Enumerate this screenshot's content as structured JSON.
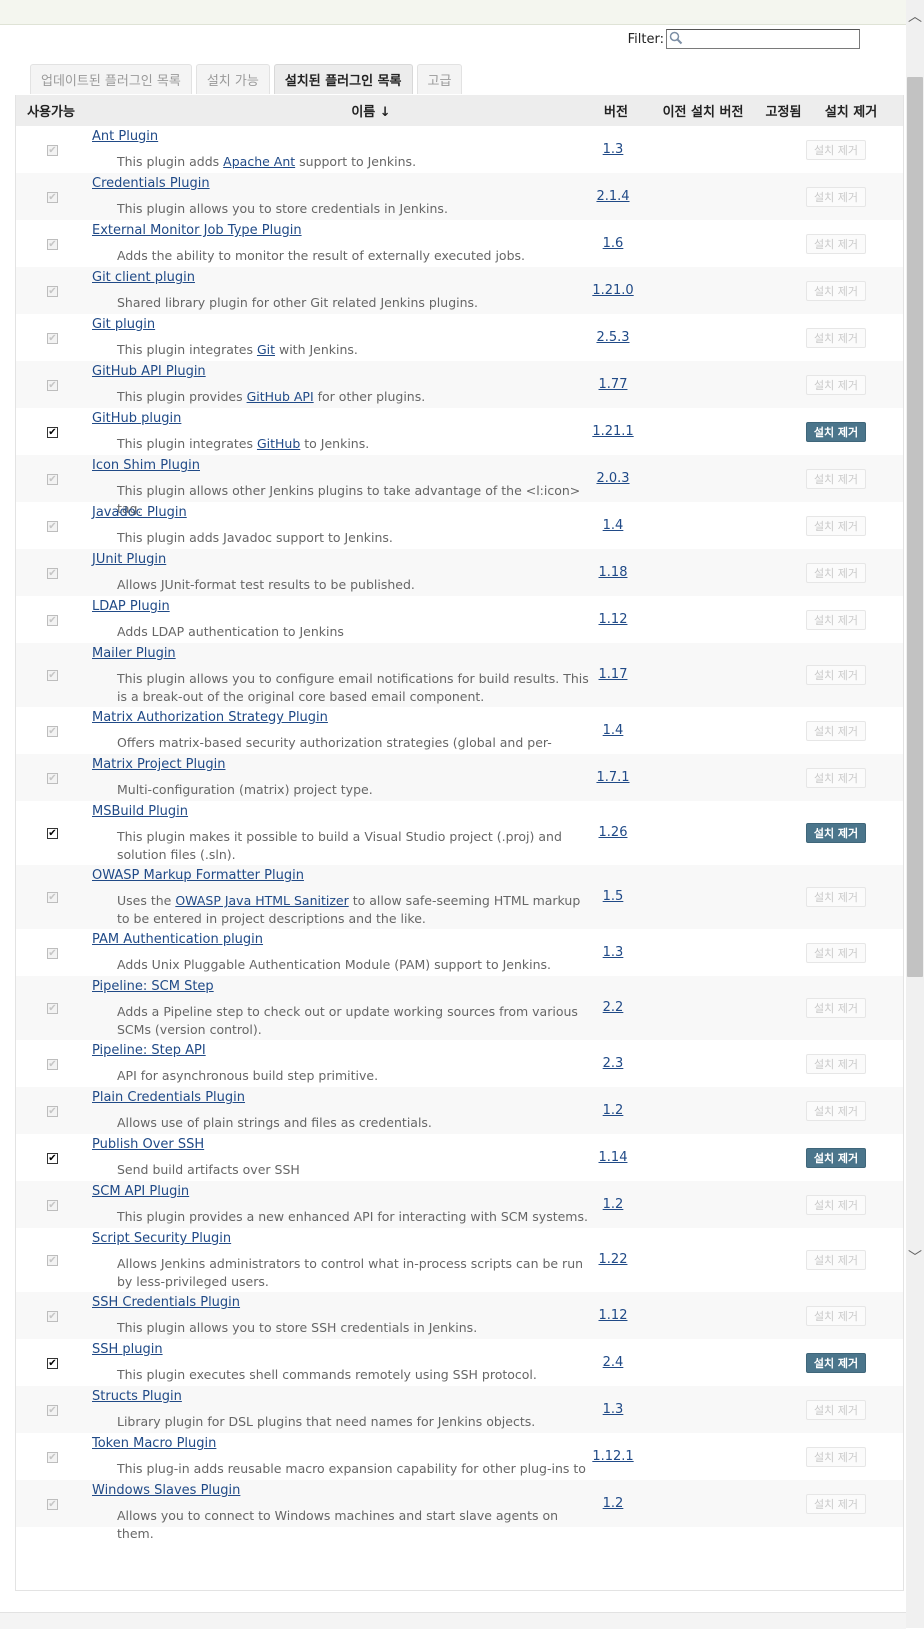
{
  "filter": {
    "label": "Filter:",
    "value": ""
  },
  "tabs": [
    {
      "label": "업데이트된 플러그인 목록",
      "active": false
    },
    {
      "label": "설치 가능",
      "active": false
    },
    {
      "label": "설치된 플러그인 목록",
      "active": true
    },
    {
      "label": "고급",
      "active": false
    }
  ],
  "table": {
    "headers": {
      "enabled": "사용가능",
      "name": "이름 ↓",
      "version": "버전",
      "previous": "이전 설치 버전",
      "pinned": "고정됨",
      "uninstall": "설치 제거"
    },
    "uninstall_label": "설치 제거",
    "rows": [
      {
        "name": "Ant Plugin",
        "desc": [
          [
            "This plugin adds ",
            false
          ],
          [
            "Apache Ant",
            true
          ],
          [
            " support to Jenkins.",
            false
          ]
        ],
        "version": "1.3",
        "enabled": false
      },
      {
        "name": "Credentials Plugin",
        "desc": [
          [
            "This plugin allows you to store credentials in Jenkins.",
            false
          ]
        ],
        "version": "2.1.4",
        "enabled": false
      },
      {
        "name": "External Monitor Job Type Plugin",
        "desc": [
          [
            "Adds the ability to monitor the result of externally executed jobs.",
            false
          ]
        ],
        "version": "1.6",
        "enabled": false
      },
      {
        "name": "Git client plugin",
        "desc": [
          [
            "Shared library plugin for other Git related Jenkins plugins.",
            false
          ]
        ],
        "version": "1.21.0",
        "enabled": false
      },
      {
        "name": "Git plugin",
        "desc": [
          [
            "This plugin integrates ",
            false
          ],
          [
            "Git",
            true
          ],
          [
            " with Jenkins.",
            false
          ]
        ],
        "version": "2.5.3",
        "enabled": false
      },
      {
        "name": "GitHub API Plugin",
        "desc": [
          [
            "This plugin provides ",
            false
          ],
          [
            "GitHub API",
            true
          ],
          [
            " for other plugins.",
            false
          ]
        ],
        "version": "1.77",
        "enabled": false
      },
      {
        "name": "GitHub plugin",
        "desc": [
          [
            "This plugin integrates ",
            false
          ],
          [
            "GitHub",
            true
          ],
          [
            " to Jenkins.",
            false
          ]
        ],
        "version": "1.21.1",
        "enabled": true
      },
      {
        "name": "Icon Shim Plugin",
        "desc": [
          [
            "This plugin allows other Jenkins plugins to take advantage of the <l:icon> tag.",
            false
          ]
        ],
        "version": "2.0.3",
        "enabled": false
      },
      {
        "name": "Javadoc Plugin",
        "desc": [
          [
            "This plugin adds Javadoc support to Jenkins.",
            false
          ]
        ],
        "version": "1.4",
        "enabled": false
      },
      {
        "name": "JUnit Plugin",
        "desc": [
          [
            "Allows JUnit-format test results to be published.",
            false
          ]
        ],
        "version": "1.18",
        "enabled": false
      },
      {
        "name": "LDAP Plugin",
        "desc": [
          [
            "Adds LDAP authentication to Jenkins",
            false
          ]
        ],
        "version": "1.12",
        "enabled": false
      },
      {
        "name": "Mailer Plugin",
        "desc": [
          [
            "This plugin allows you to configure email notifications for build results. This is a break-out of the original core based email component.",
            false
          ]
        ],
        "version": "1.17",
        "enabled": false
      },
      {
        "name": "Matrix Authorization Strategy Plugin",
        "desc": [
          [
            "Offers matrix-based security authorization strategies (global and per-project).",
            false
          ]
        ],
        "version": "1.4",
        "enabled": false
      },
      {
        "name": "Matrix Project Plugin",
        "desc": [
          [
            "Multi-configuration (matrix) project type.",
            false
          ]
        ],
        "version": "1.7.1",
        "enabled": false
      },
      {
        "name": "MSBuild Plugin",
        "desc": [
          [
            "This plugin makes it possible to build a Visual Studio project (.proj) and solution files (.sln).",
            false
          ]
        ],
        "version": "1.26",
        "enabled": true
      },
      {
        "name": "OWASP Markup Formatter Plugin",
        "desc": [
          [
            "Uses the ",
            false
          ],
          [
            "OWASP Java HTML Sanitizer",
            true
          ],
          [
            " to allow safe-seeming HTML markup to be entered in project descriptions and the like.",
            false
          ]
        ],
        "version": "1.5",
        "enabled": false
      },
      {
        "name": "PAM Authentication plugin",
        "desc": [
          [
            "Adds Unix Pluggable Authentication Module (PAM) support to Jenkins.",
            false
          ]
        ],
        "version": "1.3",
        "enabled": false
      },
      {
        "name": "Pipeline: SCM Step",
        "desc": [
          [
            "Adds a Pipeline step to check out or update working sources from various SCMs (version control).",
            false
          ]
        ],
        "version": "2.2",
        "enabled": false
      },
      {
        "name": "Pipeline: Step API",
        "desc": [
          [
            "API for asynchronous build step primitive.",
            false
          ]
        ],
        "version": "2.3",
        "enabled": false
      },
      {
        "name": "Plain Credentials Plugin",
        "desc": [
          [
            "Allows use of plain strings and files as credentials.",
            false
          ]
        ],
        "version": "1.2",
        "enabled": false
      },
      {
        "name": "Publish Over SSH",
        "desc": [
          [
            "Send build artifacts over SSH",
            false
          ]
        ],
        "version": "1.14",
        "enabled": true
      },
      {
        "name": "SCM API Plugin",
        "desc": [
          [
            "This plugin provides a new enhanced API for interacting with SCM systems.",
            false
          ]
        ],
        "version": "1.2",
        "enabled": false
      },
      {
        "name": "Script Security Plugin",
        "desc": [
          [
            "Allows Jenkins administrators to control what in-process scripts can be run by less-privileged users.",
            false
          ]
        ],
        "version": "1.22",
        "enabled": false
      },
      {
        "name": "SSH Credentials Plugin",
        "desc": [
          [
            "This plugin allows you to store SSH credentials in Jenkins.",
            false
          ]
        ],
        "version": "1.12",
        "enabled": false
      },
      {
        "name": "SSH plugin",
        "desc": [
          [
            "This plugin executes shell commands remotely using SSH protocol.",
            false
          ]
        ],
        "version": "2.4",
        "enabled": true
      },
      {
        "name": "Structs Plugin",
        "desc": [
          [
            "Library plugin for DSL plugins that need names for Jenkins objects.",
            false
          ]
        ],
        "version": "1.3",
        "enabled": false
      },
      {
        "name": "Token Macro Plugin",
        "desc": [
          [
            "This plug-in adds reusable macro expansion capability for other plug-ins to use.",
            false
          ]
        ],
        "version": "1.12.1",
        "enabled": false
      },
      {
        "name": "Windows Slaves Plugin",
        "desc": [
          [
            "Allows you to connect to Windows machines and start slave agents on them.",
            false
          ]
        ],
        "version": "1.2",
        "enabled": false
      }
    ]
  },
  "colors": {
    "link": "#204a87",
    "uninstall_active": "#4b758b",
    "header_bg": "#ededed"
  }
}
